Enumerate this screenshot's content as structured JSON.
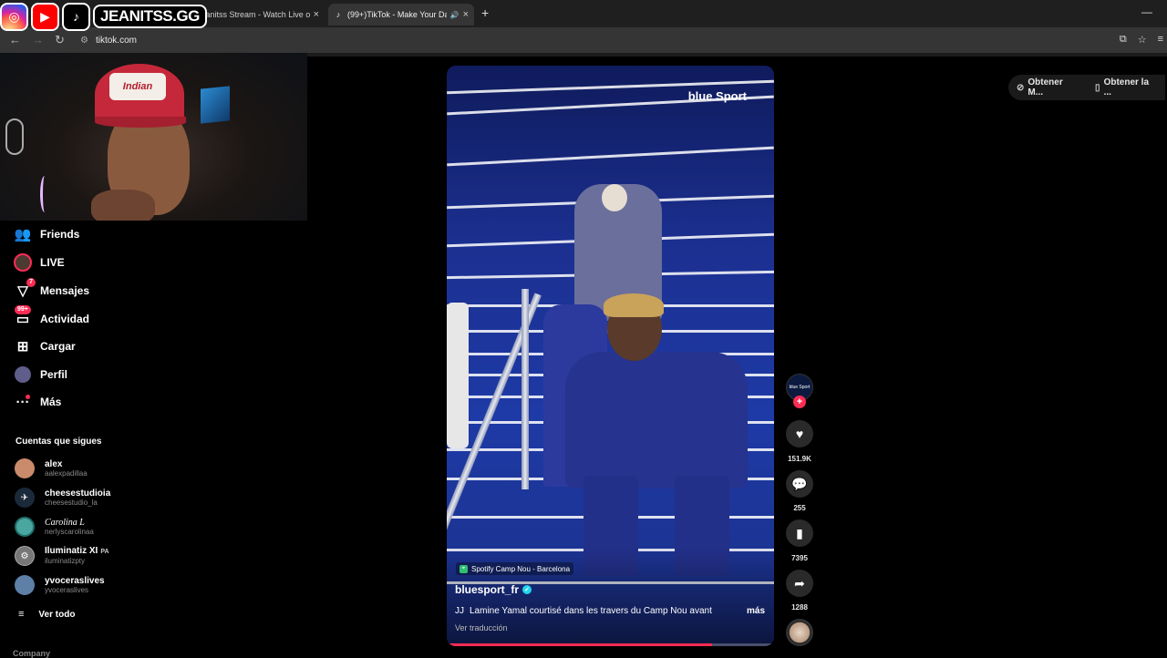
{
  "browser": {
    "tabs": [
      {
        "title": "Jeanitss Stream - Watch Live on",
        "close": "×"
      },
      {
        "title": "(99+)TikTok - Make Your Day",
        "close": "×"
      }
    ],
    "new_tab": "+",
    "minimize": "—",
    "url": "tiktok.com"
  },
  "overlay": {
    "channel": "JEANITSS.GG"
  },
  "webcam": {
    "cap_text": "Indian"
  },
  "sidebar": {
    "items": [
      {
        "label": "Friends"
      },
      {
        "label": "LIVE"
      },
      {
        "label": "Mensajes",
        "badge": "7"
      },
      {
        "label": "Actividad",
        "badge": "99+"
      },
      {
        "label": "Cargar"
      },
      {
        "label": "Perfil"
      },
      {
        "label": "Más"
      }
    ],
    "following_title": "Cuentas que sigues",
    "accounts": [
      {
        "name": "alex",
        "username": "aalexpadillaa",
        "color": "#c98b6b"
      },
      {
        "name": "cheesestudioia",
        "username": "cheesestudio_la",
        "color": "#1b2a3a"
      },
      {
        "name": "Carolina L",
        "username": "nerlyscarolinaa",
        "color": "#4aa6a0"
      },
      {
        "name": "Iluminatiz XI",
        "username": "iluminatizpty",
        "tag": "PA",
        "color": "#777777"
      },
      {
        "name": "yvoceraslives",
        "username": "yvoceraslives",
        "color": "#5d7fa8"
      }
    ],
    "see_all": "Ver todo",
    "company": "Company"
  },
  "video": {
    "watermark": "blue Sport",
    "location": "Spotify Camp Nou - Barcelona",
    "author": "bluesport_fr",
    "caption_lead": "JJ",
    "caption": "Lamine Yamal courtisé dans les travers du Camp Nou avant",
    "more": "más",
    "translate": "Ver traducción",
    "progress": 0.81
  },
  "actions": {
    "creator_label": "blue Sport",
    "likes": "151.9K",
    "comments": "255",
    "saves": "7395",
    "shares": "1288"
  },
  "top_buttons": [
    {
      "label": "Obtener M..."
    },
    {
      "label": "Obtener la ..."
    }
  ]
}
